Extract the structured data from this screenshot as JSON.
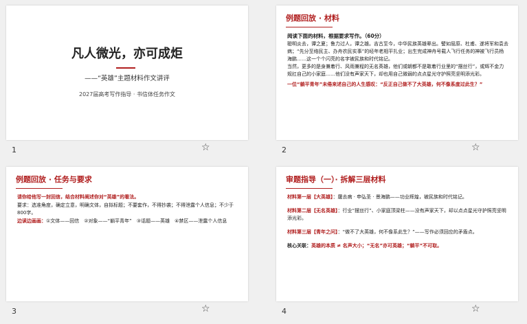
{
  "slides": [
    {
      "number": "1",
      "title": "凡人微光，亦可成炬",
      "subtitle": "——“英雄”主题材料作文讲评",
      "subtitle2": "2027届高考写作指导 · 书信体任务作文"
    },
    {
      "number": "2",
      "heading": "例题回放 · 材料",
      "lead": "阅读下面的材料，根据要求写作。（60分）",
      "p1": "聪明炎去，谭之夏；鲁力过人，谭之雄。吉古至今，中华民族英雄辈出。譬如屈原、杜甫、遂将军和袁去病；“先分至络民主、办舟农民实事”的经年老相平扎业；出生完成神舟号载人飞行任务的神被飞行员杨海鹏……这一个个闪亮的名字被民族和时代铭记。",
      "p2": "当然，更多的是身兼着行、风雨兼程的无名英雄，他们或朝都不是敢着行业里的“摆丝行”，或辉不金力规扛自己的小家庭……他们没有声家天下，却也用自己微弱的点点星光守护照亮坚明添光彩。",
      "quote": "一位“躺平青年”未倦来述自己的人生感叹：“反正自己做不了大英雄，何不像系度过此生？”"
    },
    {
      "number": "3",
      "heading": "例题回放 · 任务与要求",
      "task": "请你给他写一封回信，结合材料阐述你对“英雄”的看法。",
      "req": "要求：选准角度，确定立意，明确文体，自拟标题；不要套作，不得抄袭；不得泄露个人信息；不少于800字。",
      "boundary_label": "边读边画画：",
      "boundary": "①文体——回信　②对象——“躺平青年”　③话题——英雄　④禁区——泄露个人信息"
    },
    {
      "number": "4",
      "heading": "审题指导（一）· 拆解三层材料",
      "layer1_label": "材料第一层【大英雄】",
      "layer1": "：屠去病 · 申弘圣 · 景海鹏——功业辉煌，被民族和时代铭记。",
      "layer2_label": "材料第二层【无名英雄】",
      "layer2": "：行业“摆丝行”、小家庭顶梁柱——没有声家天下，却以点点星光守护照亮坚明添光彩。",
      "layer3_label": "材料第三层【青年之问】",
      "layer3": "：“做不了大英雄，何不像系此生？”——写作必须回应的矛盾点。",
      "core_label": "核心关联：",
      "core": "英雄的本质 ≠ 名声大小；“无名”亦可英雄；“躺平”不可取。"
    }
  ],
  "star_icon": "☆"
}
